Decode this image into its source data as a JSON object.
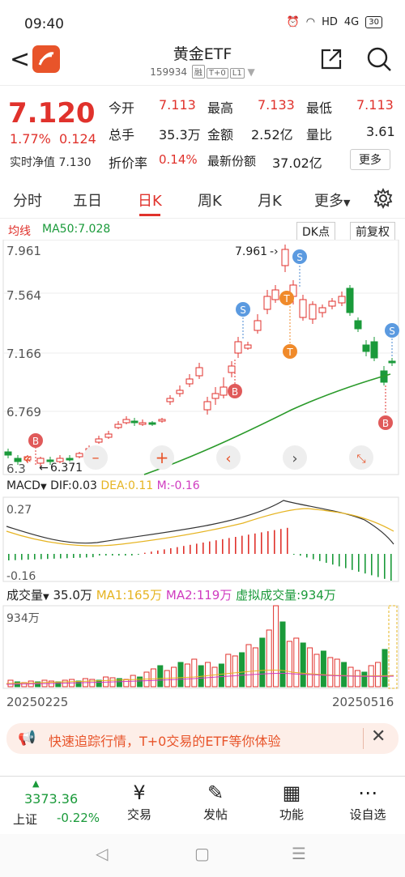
{
  "status_bar": {
    "time": "09:40",
    "network": "HD",
    "signal": "4G",
    "battery": "30"
  },
  "header": {
    "title": "黄金ETF",
    "code": "159934",
    "tags": [
      "融",
      "T+0",
      "L1"
    ]
  },
  "quote": {
    "price": "7.120",
    "change_pct": "1.77%",
    "change": "0.124",
    "nav_label": "实时净值",
    "nav_value": "7.130",
    "fields": [
      {
        "label": "今开",
        "value": "7.113",
        "color": "red"
      },
      {
        "label": "最高",
        "value": "7.133",
        "color": "red"
      },
      {
        "label": "最低",
        "value": "7.113",
        "color": "red"
      },
      {
        "label": "总手",
        "value": "35.3万",
        "color": "dark"
      },
      {
        "label": "金额",
        "value": "2.52亿",
        "color": "dark"
      },
      {
        "label": "量比",
        "value": "3.61",
        "color": "dark"
      }
    ],
    "discount_label": "折价率",
    "discount_value": "0.14%",
    "shares_label": "最新份额",
    "shares_value": "37.02亿",
    "more_button": "更多"
  },
  "tabs": [
    "分时",
    "五日",
    "日K",
    "周K",
    "月K",
    "更多"
  ],
  "active_tab": "日K",
  "kline": {
    "ma_label": "均线",
    "ma_value": "MA50:7.028",
    "dk_button": "DK点",
    "adjust_button": "前复权",
    "y_labels": [
      "7.961",
      "7.564",
      "7.166",
      "6.769",
      "6.3"
    ],
    "high_annotation": "7.961",
    "low_annotation": "6.371",
    "signal_b": "B",
    "signal_s": "S",
    "signal_t": "T"
  },
  "macd": {
    "label": "MACD",
    "dif": "DIF:0.03",
    "dea": "DEA:0.11",
    "m": "M:-0.16",
    "y_top": "0.27",
    "y_bottom": "-0.16"
  },
  "volume": {
    "label": "成交量",
    "value": "35.0万",
    "ma1": "MA1:165万",
    "ma2": "MA2:119万",
    "virtual": "虚拟成交量:934万",
    "y_top": "934万",
    "date_start": "20250225",
    "date_end": "20250516"
  },
  "banner": {
    "text": "快速追踪行情，T+0交易的ETF等你体验"
  },
  "bottom_bar": {
    "index_value": "3373.36",
    "index_name": "上证",
    "index_change": "-0.22%",
    "items": [
      "交易",
      "发帖",
      "功能",
      "设自选"
    ]
  },
  "colors": {
    "up": "#e0322c",
    "down": "#1a9a3a",
    "ma": "#2a9a2a",
    "dif": "#333333",
    "dea": "#e6b422"
  }
}
